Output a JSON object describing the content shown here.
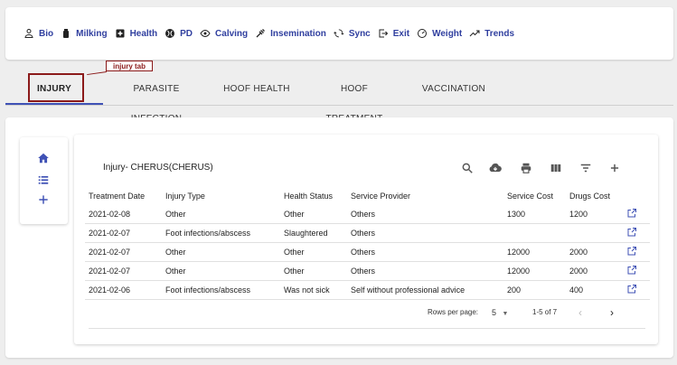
{
  "nav": [
    {
      "label": "Bio",
      "icon": "person-icon"
    },
    {
      "label": "Milking",
      "icon": "milk-icon"
    },
    {
      "label": "Health",
      "icon": "health-cross-icon"
    },
    {
      "label": "PD",
      "icon": "pd-icon"
    },
    {
      "label": "Calving",
      "icon": "eye-icon"
    },
    {
      "label": "Insemination",
      "icon": "syringe-icon"
    },
    {
      "label": "Sync",
      "icon": "sync-icon"
    },
    {
      "label": "Exit",
      "icon": "exit-icon"
    },
    {
      "label": "Weight",
      "icon": "gauge-icon"
    },
    {
      "label": "Trends",
      "icon": "trend-icon"
    }
  ],
  "tabs": [
    "INJURY",
    "PARASITE INFECTION",
    "HOOF HEALTH",
    "HOOF TREATMENT",
    "VACCINATION"
  ],
  "annotation": {
    "label": "injury tab"
  },
  "panel": {
    "title": "Injury- CHERUS(CHERUS)"
  },
  "table": {
    "headers": [
      "Treatment Date",
      "Injury Type",
      "Health Status",
      "Service Provider",
      "Service Cost",
      "Drugs Cost"
    ],
    "rows": [
      [
        "2021-02-08",
        "Other",
        "Other",
        "Others",
        "1300",
        "1200"
      ],
      [
        "2021-02-07",
        "Foot infections/abscess",
        "Slaughtered",
        "Others",
        "",
        ""
      ],
      [
        "2021-02-07",
        "Other",
        "Other",
        "Others",
        "12000",
        "2000"
      ],
      [
        "2021-02-07",
        "Other",
        "Other",
        "Others",
        "12000",
        "2000"
      ],
      [
        "2021-02-06",
        "Foot infections/abscess",
        "Was not sick",
        "Self without professional advice",
        "200",
        "400"
      ]
    ]
  },
  "pagination": {
    "rows_label": "Rows per page:",
    "rows_value": "5",
    "range": "1-5 of 7"
  },
  "colors": {
    "accent": "#3f51b5",
    "nav_text": "#303f9f",
    "annotation": "#8b1a1a"
  }
}
